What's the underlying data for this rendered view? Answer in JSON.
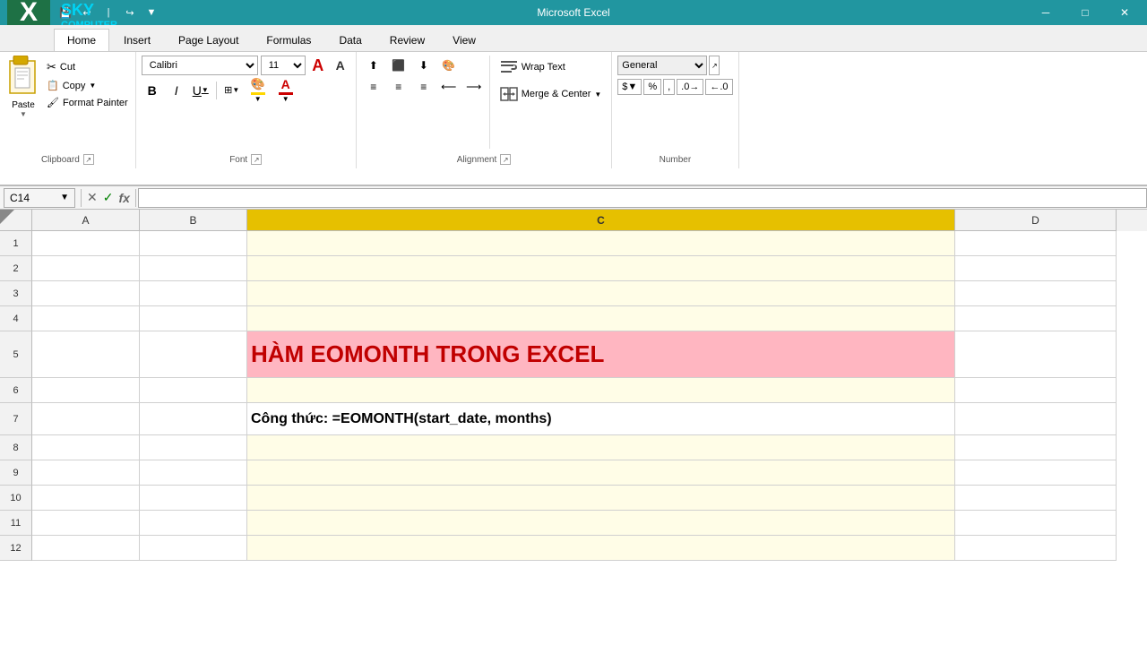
{
  "window": {
    "title": "Microsoft Excel",
    "controls": {
      "minimize": "─",
      "maximize": "□",
      "close": "✕"
    }
  },
  "logo": {
    "sky": "SKY",
    "computer": "COMPUTER",
    "x_letter": "X"
  },
  "quick_access": {
    "save_tip": "Save",
    "undo_tip": "Undo",
    "redo_tip": "Redo",
    "dropdown_tip": "Customize Quick Access Toolbar"
  },
  "tabs": [
    {
      "label": "Home",
      "active": true
    },
    {
      "label": "Insert",
      "active": false
    },
    {
      "label": "Page Layout",
      "active": false
    },
    {
      "label": "Formulas",
      "active": false
    },
    {
      "label": "Data",
      "active": false
    },
    {
      "label": "Review",
      "active": false
    },
    {
      "label": "View",
      "active": false
    }
  ],
  "ribbon": {
    "clipboard": {
      "label": "Clipboard",
      "paste": "Paste",
      "cut": "Cut",
      "copy": "Copy",
      "format_painter": "Format Painter"
    },
    "font": {
      "label": "Font",
      "name": "Calibri",
      "size": "11",
      "bold": "B",
      "italic": "I",
      "underline": "U",
      "grow": "A",
      "shrink": "A"
    },
    "alignment": {
      "label": "Alignment",
      "wrap_text": "Wrap Text",
      "merge_center": "Merge & Center"
    },
    "number": {
      "label": "Number",
      "format": "General",
      "percent": "%",
      "comma": ","
    }
  },
  "formula_bar": {
    "cell_ref": "C14",
    "cancel": "✕",
    "confirm": "✓",
    "function_btn": "fx"
  },
  "grid": {
    "columns": [
      "A",
      "B",
      "C",
      "D"
    ],
    "active_column": "C",
    "rows": [
      1,
      2,
      3,
      4,
      5,
      6,
      7,
      8,
      9,
      10,
      11,
      12
    ],
    "row5_content": "HÀM EOMONTH TRONG EXCEL",
    "row7_content": "Công thức: =EOMONTH(start_date, months)"
  }
}
